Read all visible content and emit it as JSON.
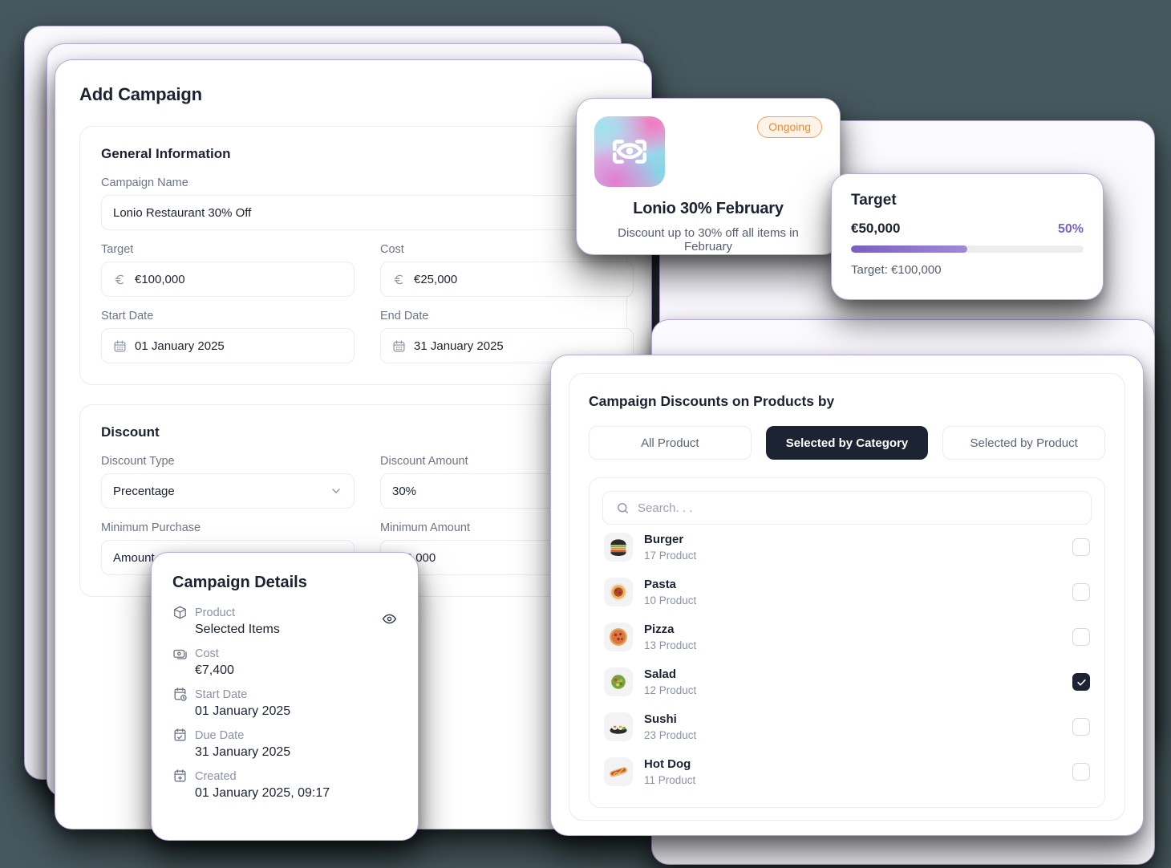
{
  "theme": {
    "page_background": "#46585e",
    "card_border": "#b8a8e0",
    "accent_purple": "#7b62c7",
    "dark": "#1c2333",
    "badge_orange": "#f08a32"
  },
  "add_campaign": {
    "title": "Add Campaign",
    "general": {
      "section_title": "General Information",
      "campaign_name_label": "Campaign Name",
      "campaign_name_value": "Lonio Restaurant 30% Off",
      "target_label": "Target",
      "target_value": "€100,000",
      "target_prefix_icon": "euro-icon",
      "cost_label": "Cost",
      "cost_value": "€25,000",
      "cost_prefix_icon": "euro-icon",
      "start_date_label": "Start Date",
      "start_date_value": "01 January 2025",
      "end_date_label": "End Date",
      "end_date_value": "31 January 2025",
      "date_icon": "calendar-icon"
    },
    "discount": {
      "section_title": "Discount",
      "discount_type_label": "Discount Type",
      "discount_type_value": "Precentage",
      "discount_amount_label": "Discount Amount",
      "discount_amount_value": "30%",
      "minimum_purchase_label": "Minimum Purchase",
      "minimum_purchase_value": "Amount",
      "minimum_amount_label": "Minimum Amount",
      "minimum_amount_value": "€10,000",
      "dropdown_icon": "chevron-down-icon"
    }
  },
  "lonio_card": {
    "status_badge": "Ongoing",
    "logo_icon": "lonio-logo",
    "name": "Lonio 30% February",
    "description": "Discount up to 30% off all items in February"
  },
  "target_card": {
    "title": "Target",
    "current": "€50,000",
    "percent_label": "50%",
    "percent_value": 50,
    "goal": "Target: €100,000"
  },
  "campaign_details": {
    "title": "Campaign Details",
    "eye_icon": "eye-icon",
    "rows": [
      {
        "icon": "package-icon",
        "key": "Product",
        "value": "Selected Items"
      },
      {
        "icon": "money-icon",
        "key": "Cost",
        "value": "€7,400"
      },
      {
        "icon": "calendar-clock-icon",
        "key": "Start Date",
        "value": "01 January 2025"
      },
      {
        "icon": "calendar-check-icon",
        "key": "Due Date",
        "value": "31 January 2025"
      },
      {
        "icon": "calendar-plus-icon",
        "key": "Created",
        "value": "01 January 2025, 09:17"
      }
    ]
  },
  "products_panel": {
    "title": "Campaign Discounts on Products by",
    "tabs": [
      {
        "label": "All Product",
        "active": false
      },
      {
        "label": "Selected by Category",
        "active": true
      },
      {
        "label": "Selected by Product",
        "active": false
      }
    ],
    "search_placeholder": "Search. . .",
    "search_value": "",
    "search_icon": "search-icon",
    "items": [
      {
        "name": "Burger",
        "count": "17 Product",
        "thumb": "burger-thumb",
        "checked": false
      },
      {
        "name": "Pasta",
        "count": "10 Product",
        "thumb": "pasta-thumb",
        "checked": false
      },
      {
        "name": "Pizza",
        "count": "13 Product",
        "thumb": "pizza-thumb",
        "checked": false
      },
      {
        "name": "Salad",
        "count": "12 Product",
        "thumb": "salad-thumb",
        "checked": true
      },
      {
        "name": "Sushi",
        "count": "23 Product",
        "thumb": "sushi-thumb",
        "checked": false
      },
      {
        "name": "Hot Dog",
        "count": "11 Product",
        "thumb": "hotdog-thumb",
        "checked": false
      }
    ]
  }
}
